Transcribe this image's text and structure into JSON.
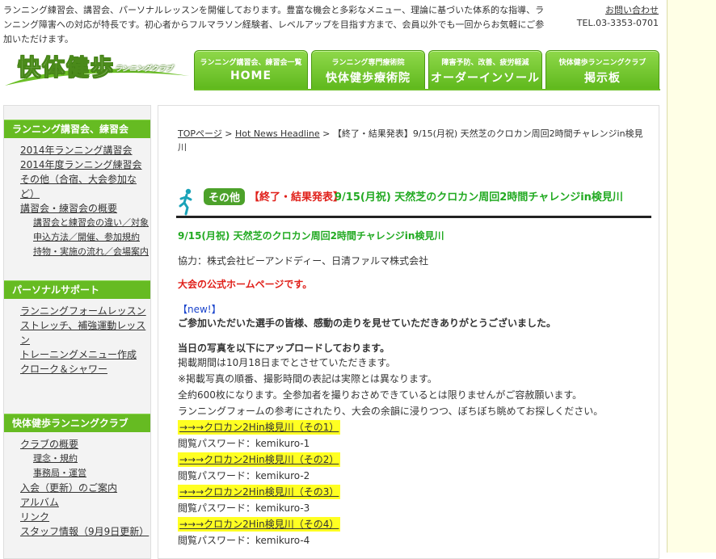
{
  "header": {
    "intro": "ランニング練習会、講習会、パーソナルレッスンを開催しております。豊富な機会と多彩なメニュー、理論に基づいた体系的な指導、ランニング障害への対応が特長です。初心者からフルマラソン経験者、レベルアップを目指す方まで、会員以外でも一回からお気軽にご参加いただけます。",
    "contact_link": "お問い合わせ",
    "tel": "TEL.03-3353-0701",
    "logo_title": "快体健歩",
    "logo_sub": "ランニングクラブ"
  },
  "nav": [
    {
      "small": "ランニング講習会、練習会一覧",
      "big": "HOME"
    },
    {
      "small": "ランニング専門療術院",
      "big": "快体健歩療術院"
    },
    {
      "small": "障害予防、改善、疲労軽減",
      "big": "オーダーインソール"
    },
    {
      "small": "快体健歩ランニングクラブ",
      "big": "掲示板"
    }
  ],
  "sidebar": {
    "s1": {
      "head": "ランニング講習会、練習会",
      "items": [
        "2014年ランニング講習会",
        "2014年度ランニング練習会",
        "その他（合宿、大会参加など）",
        "講習会・練習会の概要"
      ],
      "subitems": [
        "講習会と練習会の違い／対象",
        "申込方法／開催、参加規約",
        "持物・実施の流れ／会場案内"
      ]
    },
    "s2": {
      "head": "パーソナルサポート",
      "items": [
        "ランニングフォームレッスン",
        "ストレッチ、補強運動レッスン",
        "トレーニングメニュー作成",
        "クローク＆シャワー"
      ]
    },
    "s3": {
      "head": "快体健歩ランニングクラブ",
      "items": [
        "クラブの概要",
        "理念・規約",
        "事務局・運営",
        "入会（更新）のご案内",
        "アルバム",
        "リンク",
        "スタッフ情報（9月9日更新）"
      ]
    }
  },
  "main": {
    "breadcrumb": {
      "top": "TOPページ",
      "sep1": " > ",
      "news": "Hot News Headline",
      "sep2": " > ",
      "current": "【終了・結果発表】9/15(月祝) 天然芝のクロカン周回2時間チャレンジin検見川"
    },
    "title": {
      "badge": "その他",
      "red": "【終了・結果発表】",
      "green": "9/15(月祝) 天然芝のクロカン周回2時間チャレンジin検見川"
    },
    "subtitle": "9/15(月祝) 天然芝のクロカン周回2時間チャレンジin検見川",
    "cooperation": "協力：株式会社ビーアンドディー、日清ファルマ株式会社",
    "official_link": "大会の公式ホームページです。",
    "new_tag": "【new!】",
    "thanks": "ご参加いただいた選手の皆様、感動の走りを見せていただきありがとうございました。",
    "photos_head": "当日の写真を以下にアップロードしております。",
    "lines": [
      "掲載期間は10月18日までとさせていただきます。",
      "※掲載写真の順番、撮影時間の表記は実際とは異なります。",
      "全約600枚になります。全参加者を撮りおさめできているとは限りませんがご容赦願います。",
      "ランニングフォームの参考にされたり、大会の余韻に浸りつつ、ぼちぼち眺めてお探しください。"
    ],
    "albums": [
      {
        "link": "→→→クロカン2Hin検見川（その1）",
        "pw": "閲覧パスワード：kemikuro-1"
      },
      {
        "link": "→→→クロカン2Hin検見川（その2）",
        "pw": "閲覧パスワード：kemikuro-2"
      },
      {
        "link": "→→→クロカン2Hin検見川（その3）",
        "pw": "閲覧パスワード：kemikuro-3"
      },
      {
        "link": "→→→クロカン2Hin検見川（その4）",
        "pw": "閲覧パスワード：kemikuro-4"
      }
    ]
  },
  "colors": {
    "brand_green": "#66bb22",
    "title_red": "#e0201a",
    "title_green": "#22aa22",
    "highlight": "#ffff22"
  }
}
